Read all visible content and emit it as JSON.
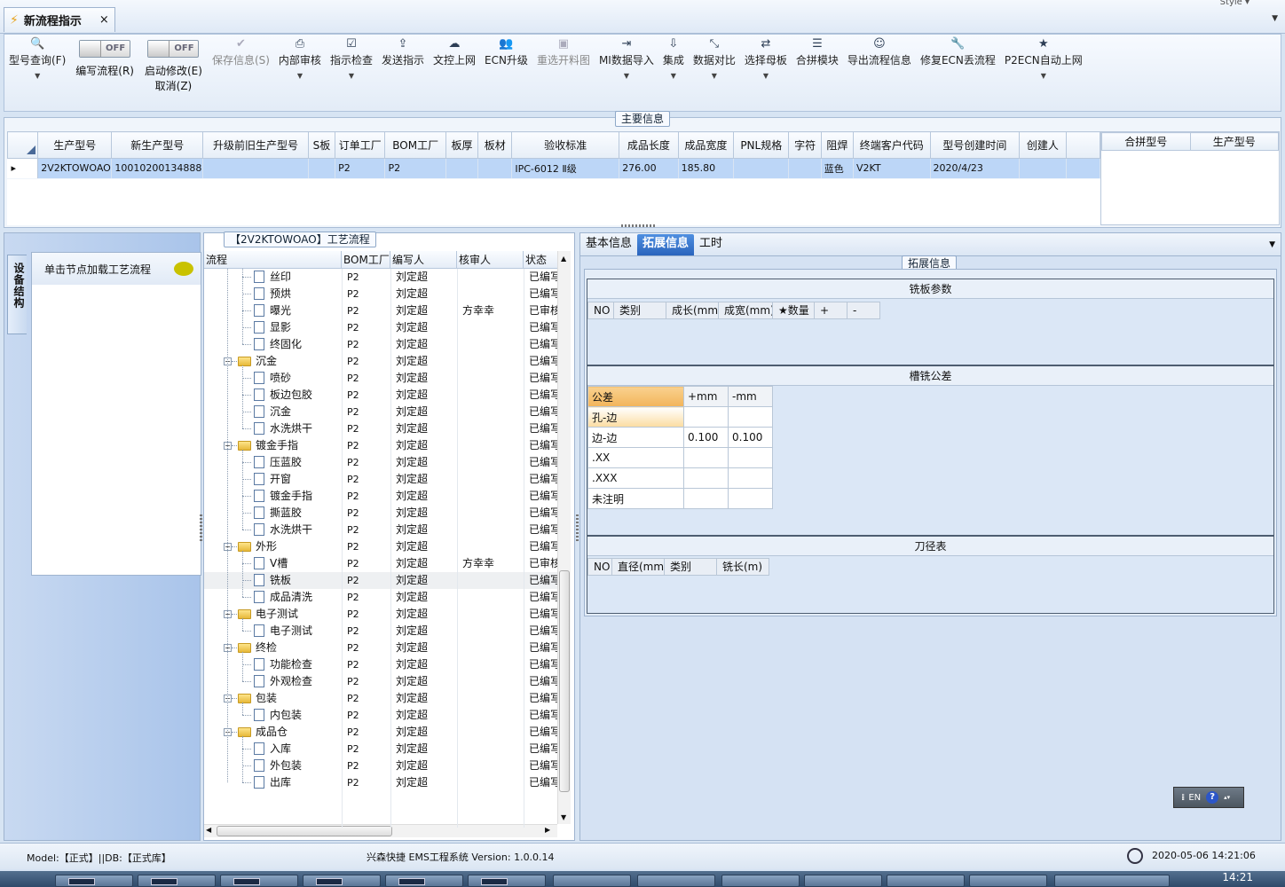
{
  "window": {
    "tab_title": "新流程指示",
    "close": "×",
    "style_label": "Style ▾",
    "menu_arrow": "▼"
  },
  "toolbar": {
    "items": [
      {
        "label": "型号查询(F)",
        "icon": "search-icon",
        "dropdown": true,
        "enabled": true
      },
      {
        "label": "编写流程(R)",
        "icon": "toggle-switch",
        "toggle": "OFF",
        "enabled": true
      },
      {
        "label": "启动修改(E)",
        "label2": "取消(Z)",
        "icon": "toggle-switch",
        "toggle": "OFF",
        "enabled": true
      },
      {
        "label": "保存信息(S)",
        "icon": "check-icon",
        "enabled": false
      },
      {
        "label": "内部审核",
        "icon": "printer-icon",
        "dropdown": true,
        "enabled": true
      },
      {
        "label": "指示检查",
        "icon": "checkbox-icon",
        "dropdown": true,
        "enabled": true
      },
      {
        "label": "发送指示",
        "icon": "upload-icon",
        "enabled": true
      },
      {
        "label": "文控上网",
        "icon": "cloud-upload-icon",
        "enabled": true
      },
      {
        "label": "ECN升级",
        "icon": "people-icon",
        "enabled": true
      },
      {
        "label": "重选开料图",
        "icon": "image-icon",
        "enabled": false
      },
      {
        "label": "MI数据导入",
        "icon": "import-icon",
        "dropdown": true,
        "enabled": true
      },
      {
        "label": "集成",
        "icon": "download-icon",
        "dropdown": true,
        "enabled": true
      },
      {
        "label": "数据对比",
        "icon": "compress-icon",
        "dropdown": true,
        "enabled": true
      },
      {
        "label": "选择母板",
        "icon": "shuffle-icon",
        "dropdown": true,
        "enabled": true
      },
      {
        "label": "合拼模块",
        "icon": "list-icon",
        "enabled": true
      },
      {
        "label": "导出流程信息",
        "icon": "smile-icon",
        "enabled": true
      },
      {
        "label": "修复ECN丢流程",
        "icon": "wrench-icon",
        "enabled": true
      },
      {
        "label": "P2ECN自动上网",
        "icon": "star-icon",
        "dropdown": true,
        "enabled": true
      }
    ]
  },
  "main_info": {
    "title": "主要信息",
    "columns": [
      "生产型号",
      "新生产型号",
      "升级前旧生产型号",
      "S板",
      "订单工厂",
      "BOM工厂",
      "板厚",
      "板材",
      "验收标准",
      "成品长度",
      "成品宽度",
      "PNL规格",
      "字符",
      "阻焊",
      "终端客户代码",
      "型号创建时间",
      "创建人"
    ],
    "row": [
      "2V2KTOWOAO",
      "10010200134888",
      "",
      "",
      "P2",
      "P2",
      "",
      "",
      "IPC-6012 Ⅱ级",
      "276.00",
      "185.80",
      "",
      "",
      "蓝色",
      "V2KT",
      "2020/4/23",
      ""
    ],
    "combo_columns": [
      "合拼型号",
      "生产型号"
    ]
  },
  "left_panel": {
    "vtab": "设备结构",
    "header": "单击节点加载工艺流程"
  },
  "process": {
    "title": "【2V2KTOWOAO】工艺流程",
    "columns": [
      "流程",
      "BOM工厂",
      "编写人",
      "核审人",
      "状态"
    ],
    "rows": [
      {
        "name": "丝印",
        "level": 1,
        "factory": "P2",
        "writer": "刘定超",
        "reviewer": "",
        "status": "已编写"
      },
      {
        "name": "预烘",
        "level": 1,
        "factory": "P2",
        "writer": "刘定超",
        "reviewer": "",
        "status": "已编写"
      },
      {
        "name": "曝光",
        "level": 1,
        "factory": "P2",
        "writer": "刘定超",
        "reviewer": "方幸幸",
        "status": "已审核"
      },
      {
        "name": "显影",
        "level": 1,
        "factory": "P2",
        "writer": "刘定超",
        "reviewer": "",
        "status": "已编写"
      },
      {
        "name": "终固化",
        "level": 1,
        "factory": "P2",
        "writer": "刘定超",
        "reviewer": "",
        "status": "已编写"
      },
      {
        "name": "沉金",
        "level": 0,
        "factory": "P2",
        "writer": "刘定超",
        "reviewer": "",
        "status": "已编写"
      },
      {
        "name": "喷砂",
        "level": 1,
        "factory": "P2",
        "writer": "刘定超",
        "reviewer": "",
        "status": "已编写"
      },
      {
        "name": "板边包胶",
        "level": 1,
        "factory": "P2",
        "writer": "刘定超",
        "reviewer": "",
        "status": "已编写"
      },
      {
        "name": "沉金",
        "level": 1,
        "factory": "P2",
        "writer": "刘定超",
        "reviewer": "",
        "status": "已编写"
      },
      {
        "name": "水洗烘干",
        "level": 1,
        "factory": "P2",
        "writer": "刘定超",
        "reviewer": "",
        "status": "已编写"
      },
      {
        "name": "镀金手指",
        "level": 0,
        "factory": "P2",
        "writer": "刘定超",
        "reviewer": "",
        "status": "已编写"
      },
      {
        "name": "压蓝胶",
        "level": 1,
        "factory": "P2",
        "writer": "刘定超",
        "reviewer": "",
        "status": "已编写"
      },
      {
        "name": "开窗",
        "level": 1,
        "factory": "P2",
        "writer": "刘定超",
        "reviewer": "",
        "status": "已编写"
      },
      {
        "name": "镀金手指",
        "level": 1,
        "factory": "P2",
        "writer": "刘定超",
        "reviewer": "",
        "status": "已编写"
      },
      {
        "name": "撕蓝胶",
        "level": 1,
        "factory": "P2",
        "writer": "刘定超",
        "reviewer": "",
        "status": "已编写"
      },
      {
        "name": "水洗烘干",
        "level": 1,
        "factory": "P2",
        "writer": "刘定超",
        "reviewer": "",
        "status": "已编写"
      },
      {
        "name": "外形",
        "level": 0,
        "factory": "P2",
        "writer": "刘定超",
        "reviewer": "",
        "status": "已编写"
      },
      {
        "name": "V槽",
        "level": 1,
        "factory": "P2",
        "writer": "刘定超",
        "reviewer": "方幸幸",
        "status": "已审核"
      },
      {
        "name": "铣板",
        "level": 1,
        "factory": "P2",
        "writer": "刘定超",
        "reviewer": "",
        "status": "已编写",
        "selected": true
      },
      {
        "name": "成品清洗",
        "level": 1,
        "factory": "P2",
        "writer": "刘定超",
        "reviewer": "",
        "status": "已编写"
      },
      {
        "name": "电子测试",
        "level": 0,
        "factory": "P2",
        "writer": "刘定超",
        "reviewer": "",
        "status": "已编写"
      },
      {
        "name": "电子测试",
        "level": 1,
        "factory": "P2",
        "writer": "刘定超",
        "reviewer": "",
        "status": "已编写"
      },
      {
        "name": "终检",
        "level": 0,
        "factory": "P2",
        "writer": "刘定超",
        "reviewer": "",
        "status": "已编写"
      },
      {
        "name": "功能检查",
        "level": 1,
        "factory": "P2",
        "writer": "刘定超",
        "reviewer": "",
        "status": "已编写"
      },
      {
        "name": "外观检查",
        "level": 1,
        "factory": "P2",
        "writer": "刘定超",
        "reviewer": "",
        "status": "已编写"
      },
      {
        "name": "包装",
        "level": 0,
        "factory": "P2",
        "writer": "刘定超",
        "reviewer": "",
        "status": "已编写"
      },
      {
        "name": "内包装",
        "level": 1,
        "factory": "P2",
        "writer": "刘定超",
        "reviewer": "",
        "status": "已编写"
      },
      {
        "name": "成品仓",
        "level": 0,
        "factory": "P2",
        "writer": "刘定超",
        "reviewer": "",
        "status": "已编写"
      },
      {
        "name": "入库",
        "level": 1,
        "factory": "P2",
        "writer": "刘定超",
        "reviewer": "",
        "status": "已编写"
      },
      {
        "name": "外包装",
        "level": 1,
        "factory": "P2",
        "writer": "刘定超",
        "reviewer": "",
        "status": "已编写"
      },
      {
        "name": "出库",
        "level": 1,
        "factory": "P2",
        "writer": "刘定超",
        "reviewer": "",
        "status": "已编写"
      }
    ]
  },
  "right_panel": {
    "tabs": [
      "基本信息",
      "拓展信息",
      "工时"
    ],
    "active_tab": 1,
    "group_title": "拓展信息",
    "milling": {
      "title": "铣板参数",
      "columns": [
        "NO",
        "类别",
        "成长(mm)",
        "成宽(mm)",
        "★数量",
        "+",
        "-"
      ]
    },
    "tolerance": {
      "title": "槽铣公差",
      "header": [
        "公差",
        "+mm",
        "-mm"
      ],
      "rows": [
        [
          "孔-边",
          "",
          ""
        ],
        [
          "边-边",
          "0.100",
          "0.100"
        ],
        [
          ".XX",
          "",
          ""
        ],
        [
          ".XXX",
          "",
          ""
        ],
        [
          "未注明",
          "",
          ""
        ]
      ]
    },
    "tools": {
      "title": "刀径表",
      "columns": [
        "NO",
        "直径(mm)",
        "类别",
        "铣长(m)"
      ]
    }
  },
  "lang_bar": {
    "lang": "EN",
    "help": "?"
  },
  "status": {
    "model": "Model:【正式】||DB:【正式库】",
    "app": "兴森快捷 EMS工程系统 Version: 1.0.0.14",
    "datetime": "2020-05-06 14:21:06"
  },
  "taskbar": {
    "time": "14:21"
  }
}
